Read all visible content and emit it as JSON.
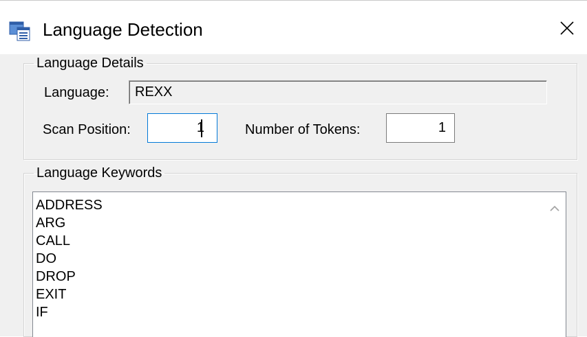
{
  "window": {
    "title": "Language Detection",
    "icon": "application-window-icon",
    "close": "close-icon"
  },
  "details": {
    "legend": "Language Details",
    "language_label": "Language:",
    "language_value": "REXX",
    "scan_label": "Scan Position:",
    "scan_value": "1",
    "tokens_label": "Number of Tokens:",
    "tokens_value": "1"
  },
  "keywords": {
    "legend": "Language Keywords",
    "items": [
      "ADDRESS",
      "ARG",
      "CALL",
      "DO",
      "DROP",
      "EXIT",
      "IF"
    ]
  },
  "colors": {
    "focus_border": "#0078d7",
    "dialog_bg": "#f0f0f0"
  }
}
